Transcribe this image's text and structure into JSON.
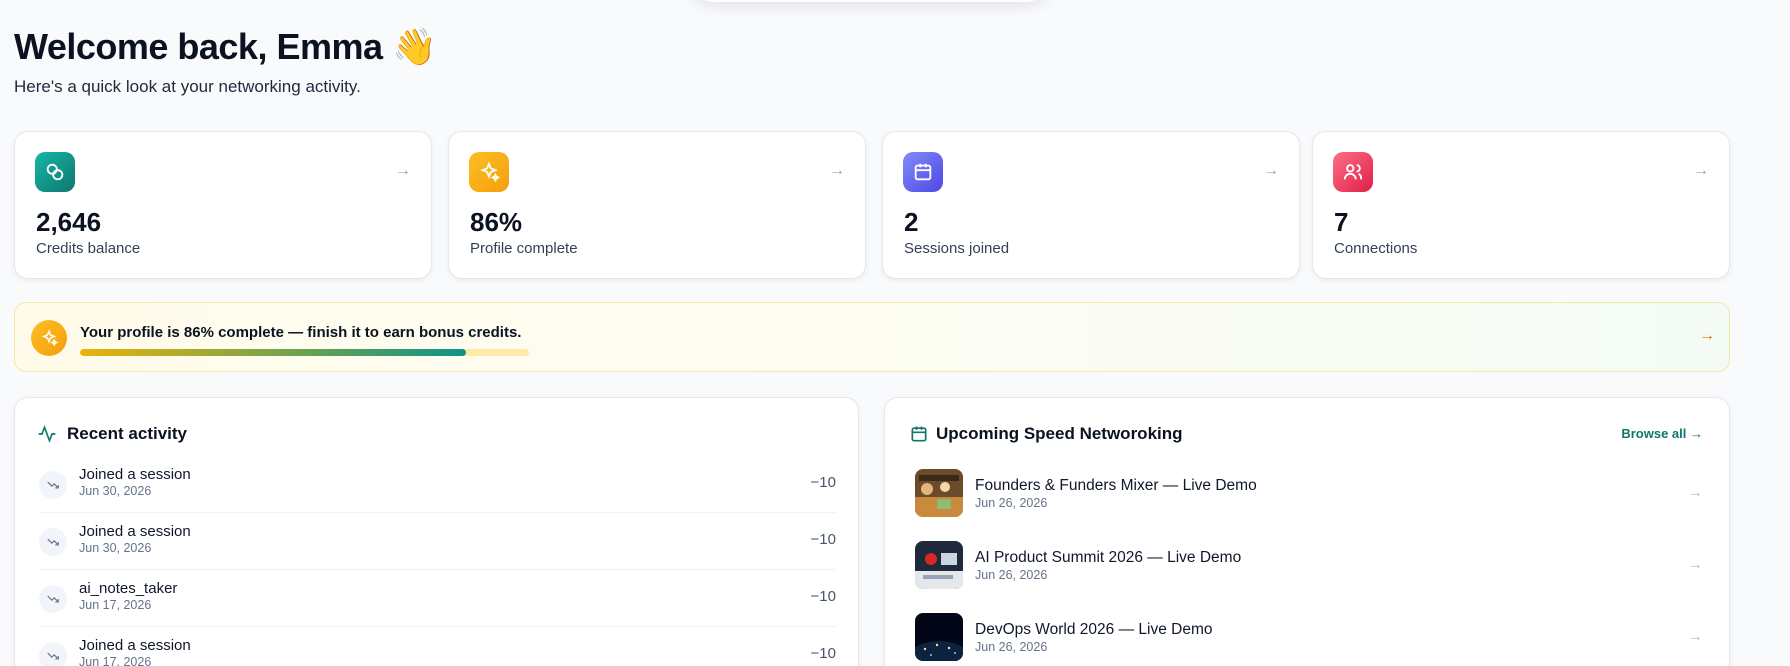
{
  "header": {
    "title": "Welcome back, Emma",
    "emoji": "👋",
    "subtitle": "Here's a quick look at your networking activity."
  },
  "stats": [
    {
      "value": "2,646",
      "label": "Credits balance",
      "icon": "coins-icon",
      "color": "#0f766e"
    },
    {
      "value": "86%",
      "label": "Profile complete",
      "icon": "sparkles-icon",
      "color": "#f59e0b"
    },
    {
      "value": "2",
      "label": "Sessions joined",
      "icon": "calendar-icon",
      "color": "#6366f1"
    },
    {
      "value": "7",
      "label": "Connections",
      "icon": "users-icon",
      "color": "#f43f5e"
    }
  ],
  "banner": {
    "text": "Your profile is 86% complete — finish it to earn bonus credits.",
    "progress": 0.86
  },
  "recent_activity": {
    "title": "Recent activity",
    "items": [
      {
        "name": "Joined a session",
        "date": "Jun 30, 2026",
        "amount": "−10"
      },
      {
        "name": "Joined a session",
        "date": "Jun 30, 2026",
        "amount": "−10"
      },
      {
        "name": "ai_notes_taker",
        "date": "Jun 17, 2026",
        "amount": "−10"
      },
      {
        "name": "Joined a session",
        "date": "Jun 17, 2026",
        "amount": "−10"
      }
    ]
  },
  "upcoming": {
    "title": "Upcoming Speed Networoking",
    "browse_label": "Browse all →",
    "events": [
      {
        "name": "Founders & Funders Mixer — Live Demo",
        "date": "Jun 26, 2026"
      },
      {
        "name": "AI Product Summit 2026 — Live Demo",
        "date": "Jun 26, 2026"
      },
      {
        "name": "DevOps World 2026 — Live Demo",
        "date": "Jun 26, 2026"
      }
    ]
  },
  "colors": {
    "accent": "#0f766e",
    "amber": "#f59e0b",
    "indigo": "#6366f1",
    "rose": "#f43f5e"
  }
}
